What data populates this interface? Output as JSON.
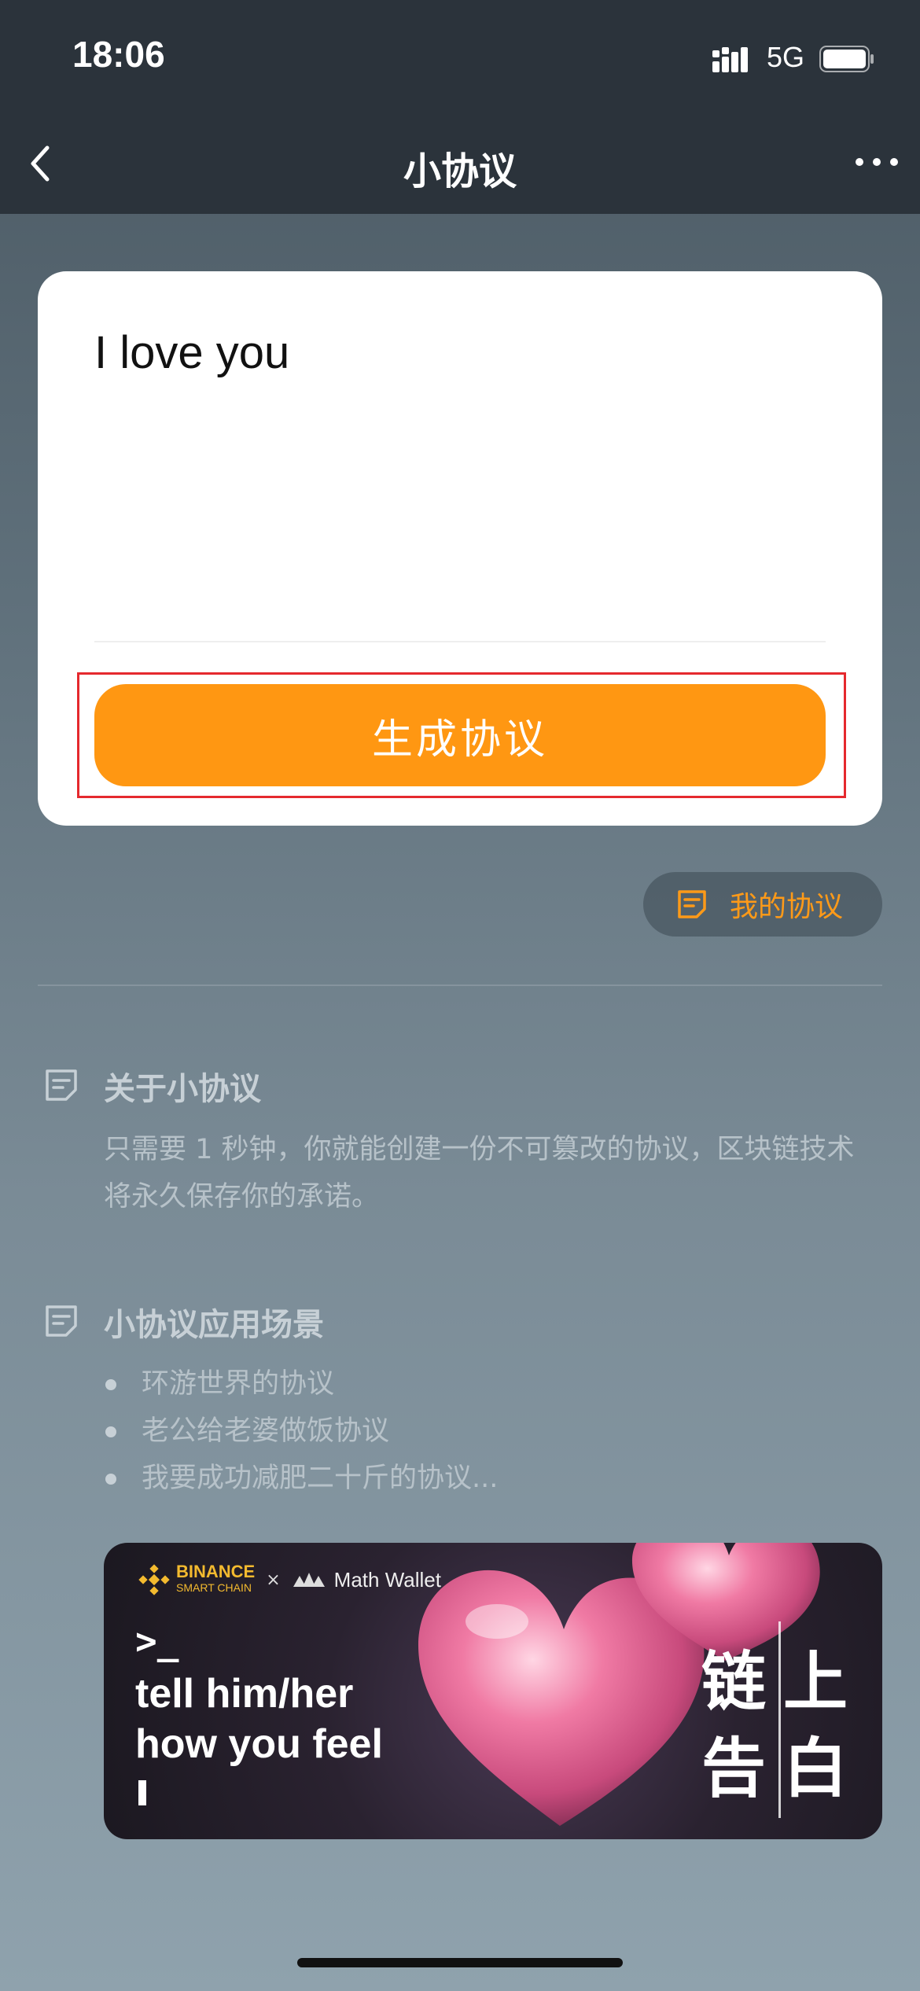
{
  "status_bar": {
    "time": "18:06",
    "network": "5G"
  },
  "nav": {
    "title": "小协议"
  },
  "card": {
    "input_value": "I love you",
    "generate_label": "生成协议"
  },
  "my_agreement_label": "我的协议",
  "about": {
    "title": "关于小协议",
    "description": "只需要 1 秒钟，你就能创建一份不可篡改的协议，区块链技术将永久保存你的承诺。"
  },
  "scenes": {
    "title": "小协议应用场景",
    "items": [
      "环游世界的协议",
      "老公给老婆做饭协议",
      "我要成功减肥二十斤的协议..."
    ]
  },
  "banner": {
    "brand_main": "BINANCE",
    "brand_sub": "SMART CHAIN",
    "brand_x": "×",
    "brand_partner": "Math Wallet",
    "prompt": ">_",
    "line1": "tell him/her",
    "line2": "how you feel",
    "cn_1": "链",
    "cn_2": "上",
    "cn_3": "告",
    "cn_4": "白"
  },
  "colors": {
    "accent": "#ff9712",
    "nav_bg": "#2b333b",
    "highlight": "#e5292e"
  }
}
